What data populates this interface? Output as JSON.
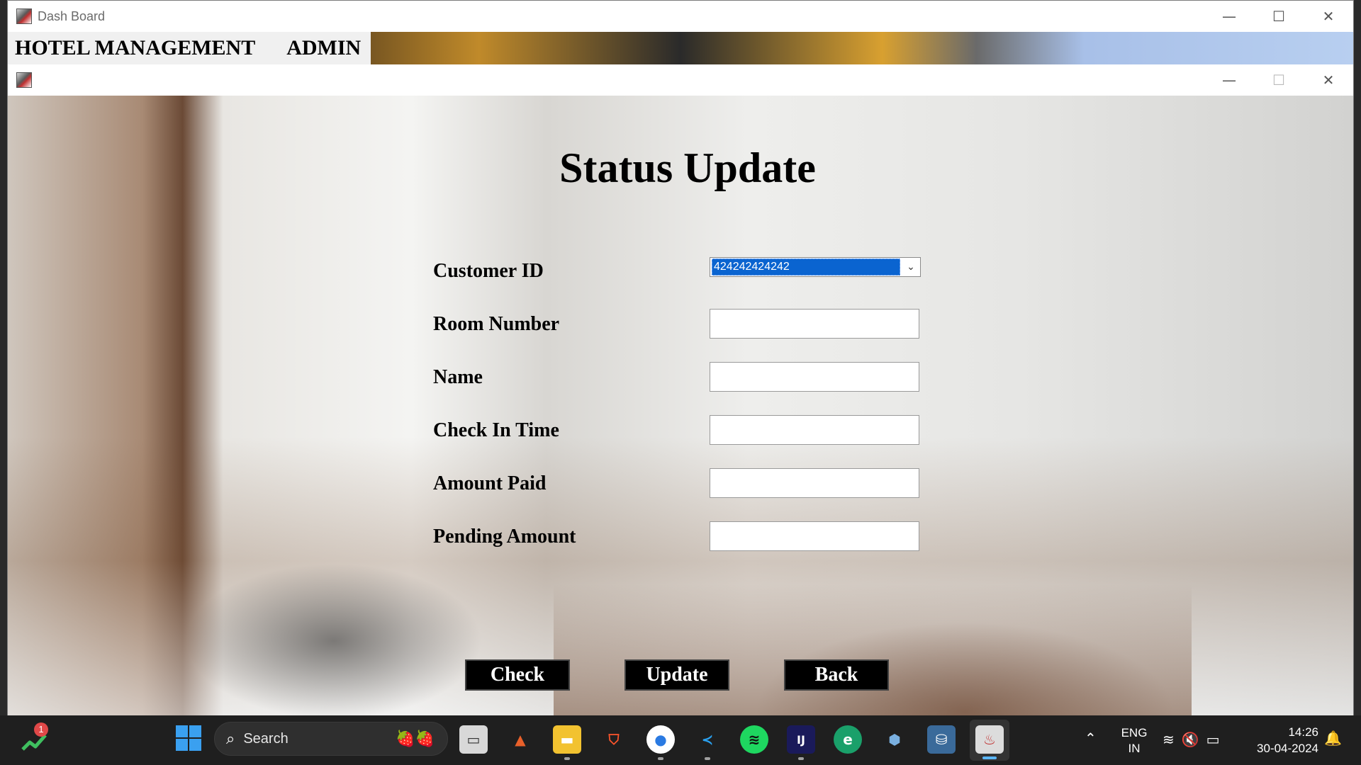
{
  "outer_window": {
    "title": "Dash Board",
    "controls": {
      "minimize": "—",
      "maximize": "☐",
      "close": "✕"
    }
  },
  "menu": {
    "hotel_management": "HOTEL MANAGEMENT",
    "admin": "ADMIN"
  },
  "inner_window": {
    "controls": {
      "minimize": "—",
      "maximize": "☐",
      "close": "✕"
    }
  },
  "form": {
    "title": "Status Update",
    "labels": {
      "customer_id": "Customer ID",
      "room_number": "Room Number",
      "name": "Name",
      "check_in_time": "Check In Time",
      "amount_paid": "Amount Paid",
      "pending_amount": "Pending Amount"
    },
    "values": {
      "customer_id": "424242424242",
      "room_number": "",
      "name": "",
      "check_in_time": "",
      "amount_paid": "",
      "pending_amount": ""
    },
    "buttons": {
      "check": "Check",
      "update": "Update",
      "back": "Back"
    }
  },
  "taskbar": {
    "widget_badge": "1",
    "search_label": "Search",
    "language": "ENG",
    "region": "IN",
    "time": "14:26",
    "date": "30-04-2024",
    "apps": [
      "task-view",
      "matlab",
      "file-explorer",
      "brave",
      "chrome",
      "vscode",
      "spotify",
      "intellij",
      "edge",
      "virtualbox",
      "mysql-workbench",
      "java"
    ]
  }
}
